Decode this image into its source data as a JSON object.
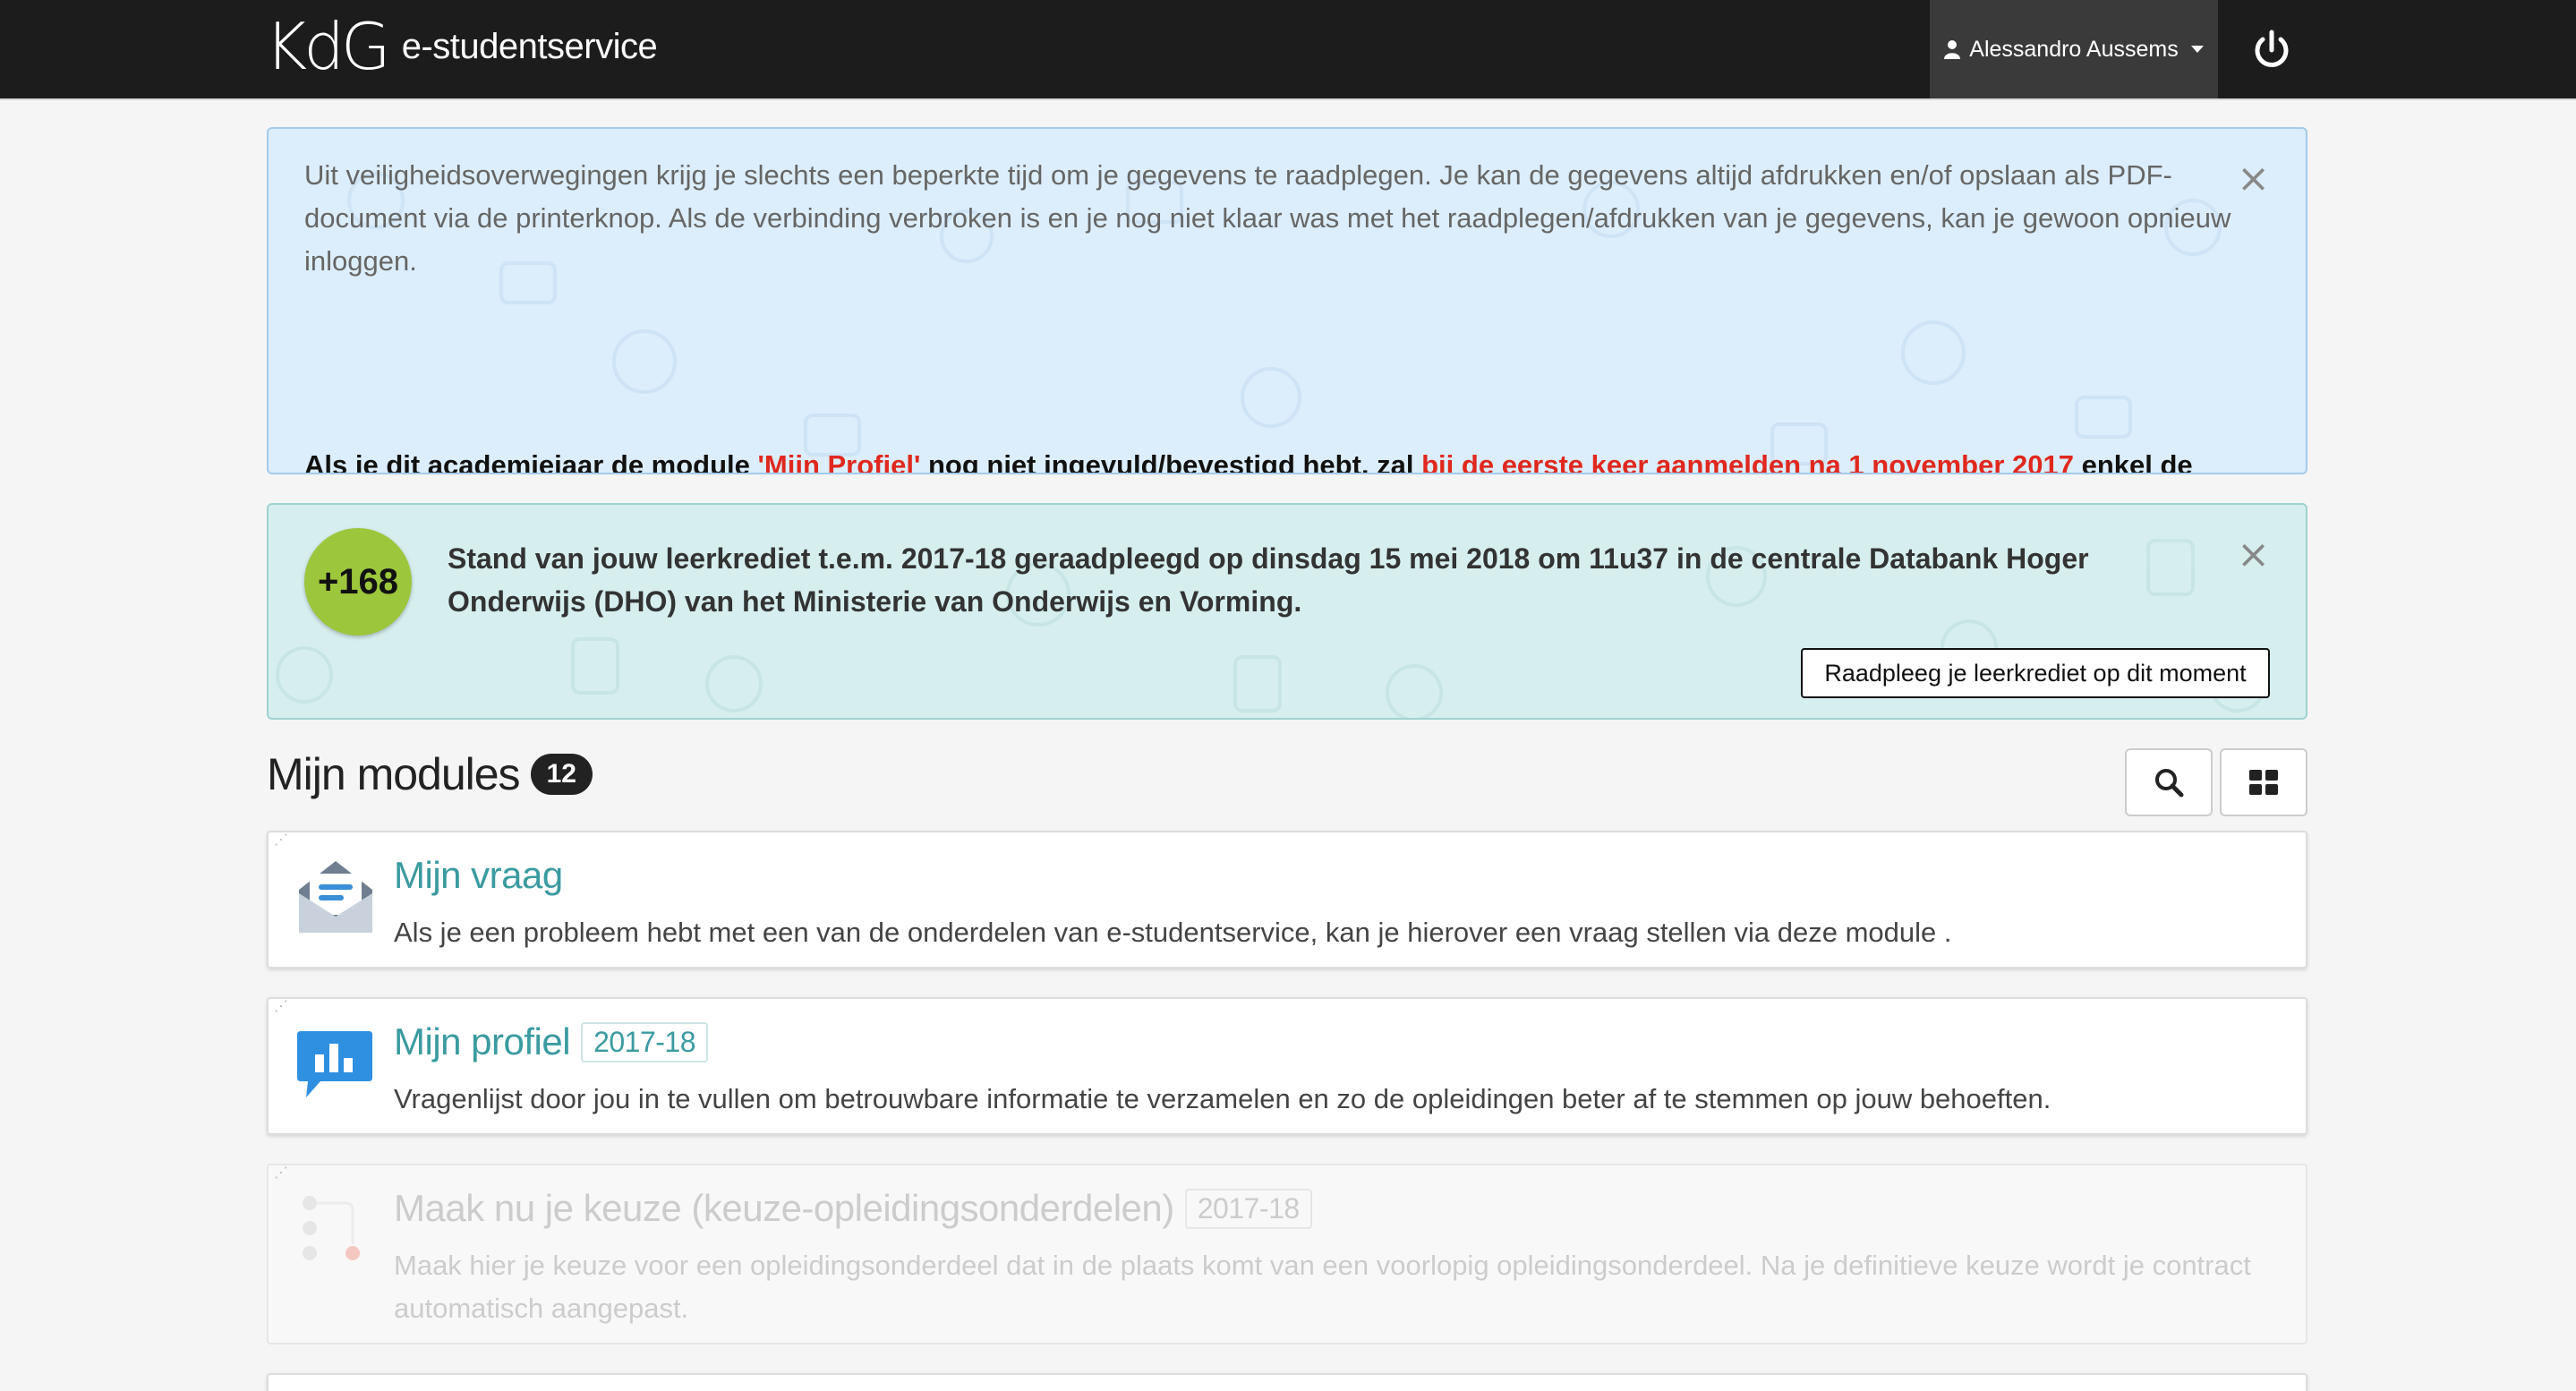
{
  "header": {
    "logo_text": "KdG",
    "app_name": "e-studentservice",
    "user_name": "Alessandro Aussems"
  },
  "alerts": {
    "info": {
      "paragraph": "Uit veiligheidsoverwegingen krijg je slechts een beperkte tijd om je gegevens te raadplegen. Je kan de gegevens altijd afdrukken en/of opslaan als PDF-document via de printerknop. Als de verbinding verbroken is en je nog niet klaar was met het raadplegen/afdrukken van je gegevens, kan je gewoon opnieuw inloggen.",
      "bold_part1": "Als je dit academiejaar de module ",
      "bold_module": "'Mijn Profiel'",
      "bold_part2": " nog niet ingevuld/bevestigd hebt, zal ",
      "bold_date": " bij de eerste keer aanmelden na 1 november 2017",
      "bold_part3": " enkel de module 'Mijn profiel' aangeboden worden vooraleer je de andere modules kan openen. Vul de vragenlijst in of bevestig je antwoorden uit een voorgaand academiejaar. Daarna heb je weer toegang tot alle modules zoals voorheen. Bedankt voor je medewerking.",
      "close_label": "×"
    },
    "credit": {
      "badge": "+168",
      "text": "Stand van jouw leerkrediet t.e.m. 2017-18 geraadpleegd op dinsdag 15 mei 2018 om 11u37 in de centrale Databank Hoger Onderwijs (DHO) van het Ministerie van Onderwijs en Vorming.",
      "button": "Raadpleeg je leerkrediet op dit moment",
      "close_label": "×"
    }
  },
  "modules": {
    "title": "Mijn modules",
    "count": "12",
    "items": [
      {
        "title": "Mijn vraag",
        "year": "",
        "description": "Als je een probleem hebt met een van de onderdelen van e-studentservice, kan je hierover een vraag stellen via deze module .",
        "icon": "envelope-icon"
      },
      {
        "title": "Mijn profiel",
        "year": "2017-18",
        "description": "Vragenlijst door jou in te vullen om betrouwbare informatie te verzamelen en zo de opleidingen beter af te stemmen op jouw behoeften.",
        "icon": "chart-chat-icon"
      },
      {
        "title": "Maak nu je keuze (keuze-opleidingsonderdelen)",
        "year": "2017-18",
        "description": "Maak hier je keuze voor een opleidingsonderdeel dat in de plaats komt van een voorlopig opleidingsonderdeel. Na je definitieve keuze wordt je contract automatisch aangepast.",
        "icon": "choice-dots-icon"
      }
    ]
  },
  "colors": {
    "topbar": "#1c1c1c",
    "accent_teal": "#3a9ba0",
    "alert_red": "#e0281e",
    "credit_badge": "#9cc63b",
    "info_bg": "#dcedfb",
    "credit_bg": "#d6eeee"
  }
}
